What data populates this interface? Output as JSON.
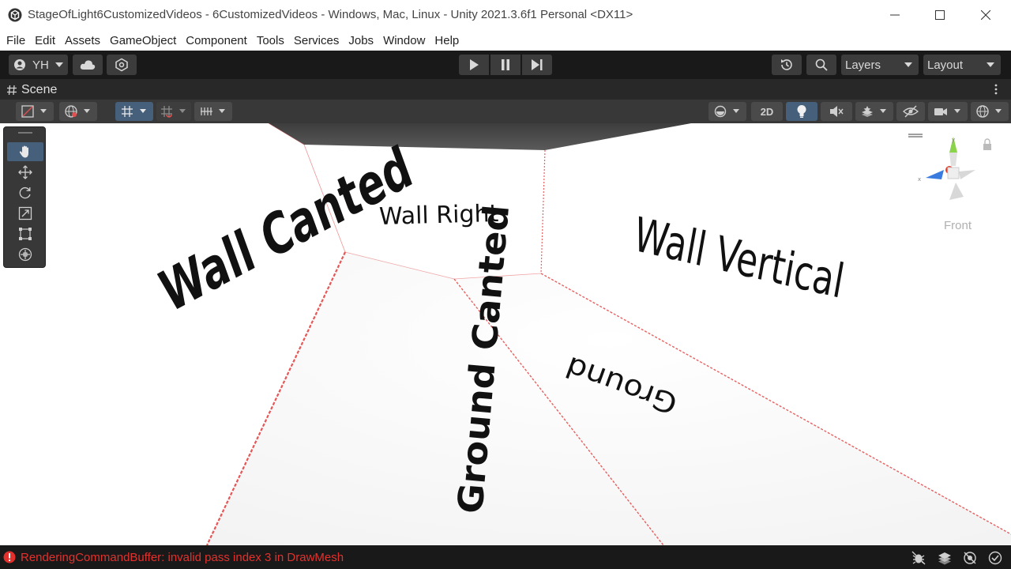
{
  "window": {
    "title": "StageOfLight6CustomizedVideos - 6CustomizedVideos - Windows, Mac, Linux - Unity 2021.3.6f1 Personal <DX11>",
    "minimize_glyph": "—",
    "maximize_glyph": "☐",
    "close_glyph": "✕"
  },
  "menu": [
    "File",
    "Edit",
    "Assets",
    "GameObject",
    "Component",
    "Tools",
    "Services",
    "Jobs",
    "Window",
    "Help"
  ],
  "toolbar": {
    "account_label": "YH",
    "layers_label": "Layers",
    "layout_label": "Layout"
  },
  "scene_tab": {
    "label": "Scene",
    "icon": "hash-icon"
  },
  "scene_toolbar": {
    "mode_2d_label": "2D"
  },
  "scene": {
    "wall_canted": "Wall Canted",
    "wall_right": "Wall Right",
    "wall_vertical": "Wall Vertical",
    "ground_canted": "Ground Canted",
    "ground": "Ground",
    "gizmo_label": "Front"
  },
  "status": {
    "message": "RenderingCommandBuffer: invalid pass index 3 in DrawMesh",
    "message_color": "#e2312d"
  },
  "colors": {
    "toolbar_bg": "#191919",
    "panel_bg": "#383838",
    "active_blue": "#46607c",
    "edge_red": "#e03030"
  }
}
